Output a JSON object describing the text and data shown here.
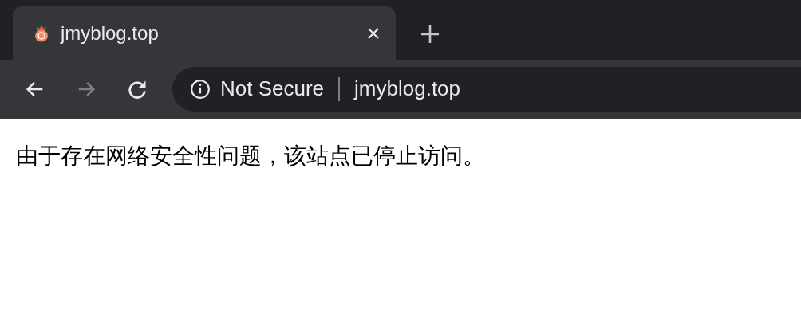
{
  "tabs": [
    {
      "title": "jmyblog.top",
      "selected": true
    }
  ],
  "toolbar": {
    "back": {
      "disabled": false
    },
    "forward": {
      "disabled": true
    }
  },
  "omnibox": {
    "security": "Not Secure",
    "url": "jmyblog.top"
  },
  "page": {
    "message": "由于存在网络安全性问题，该站点已停止访问。"
  }
}
